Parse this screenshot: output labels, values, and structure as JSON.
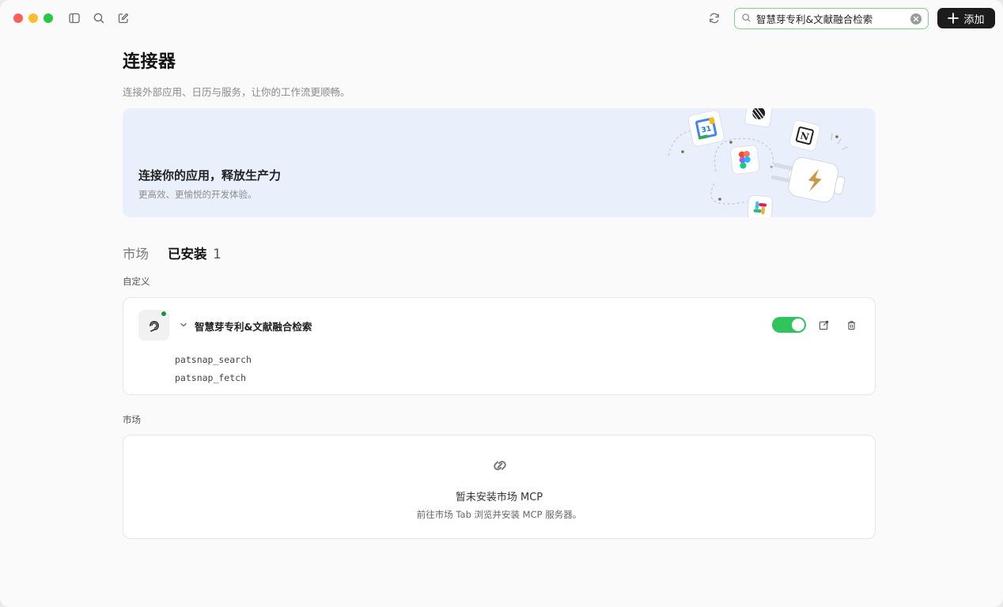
{
  "titlebar": {
    "search": {
      "value": "智慧芽专利&文献融合检索"
    },
    "add_button_label": "添加"
  },
  "page": {
    "title": "连接器",
    "subtitle": "连接外部应用、日历与服务，让你的工作流更顺畅。"
  },
  "banner": {
    "title": "连接你的应用，释放生产力",
    "subtitle": "更高效、更愉悦的开发体验。"
  },
  "tabs": [
    {
      "label": "市场",
      "active": false
    },
    {
      "label": "已安装",
      "count": "1",
      "active": true
    }
  ],
  "custom_section": {
    "label": "自定义",
    "connector": {
      "name": "智慧芽专利&文献融合检索",
      "enabled": true,
      "status_color": "#1e8f3f",
      "tools": [
        "patsnap_search",
        "patsnap_fetch"
      ]
    }
  },
  "market_section": {
    "label": "市场",
    "empty_title": "暂未安装市场 MCP",
    "empty_subtitle": "前往市场 Tab 浏览并安装 MCP 服务器。"
  },
  "colors": {
    "accent_green": "#2fc45c",
    "search_border": "#7cd18f",
    "banner_bg": "#eaf0fb",
    "add_button_bg": "#1c1c1c"
  }
}
